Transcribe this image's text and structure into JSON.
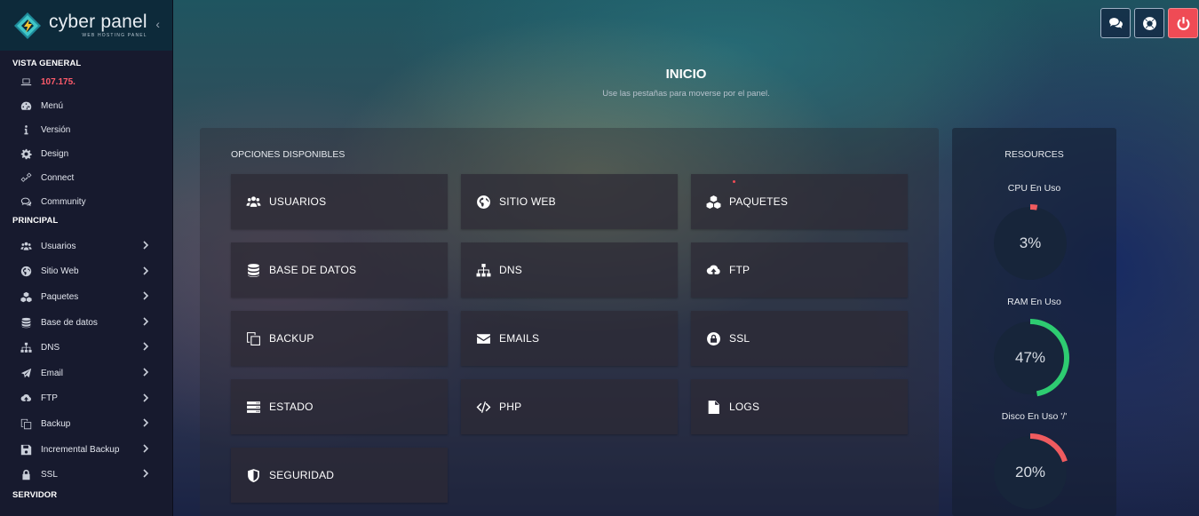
{
  "brand": {
    "name": "cyber panel",
    "subtitle": "WEB HOSTING PANEL"
  },
  "sidebar": {
    "overview_title": "VISTA GENERAL",
    "overview_items": [
      {
        "label": "107.175.",
        "icon": "laptop-icon"
      },
      {
        "label": "Menú",
        "icon": "dashboard-icon"
      },
      {
        "label": "Versión",
        "icon": "info-icon"
      },
      {
        "label": "Design",
        "icon": "gear-icon"
      },
      {
        "label": "Connect",
        "icon": "link-icon"
      },
      {
        "label": "Community",
        "icon": "comments-icon"
      }
    ],
    "main_title": "PRINCIPAL",
    "main_items": [
      {
        "label": "Usuarios",
        "icon": "users-icon"
      },
      {
        "label": "Sitio Web",
        "icon": "globe-icon"
      },
      {
        "label": "Paquetes",
        "icon": "cubes-icon"
      },
      {
        "label": "Base de datos",
        "icon": "database-icon"
      },
      {
        "label": "DNS",
        "icon": "sitemap-icon"
      },
      {
        "label": "Email",
        "icon": "paper-plane-icon"
      },
      {
        "label": "FTP",
        "icon": "cloud-upload-icon"
      },
      {
        "label": "Backup",
        "icon": "copy-icon"
      },
      {
        "label": "Incremental Backup",
        "icon": "save-icon"
      },
      {
        "label": "SSL",
        "icon": "lock-icon"
      }
    ],
    "server_title": "SERVIDOR"
  },
  "header": {
    "title": "INICIO",
    "subtitle": "Use las pestañas para moverse por el panel.",
    "buttons": [
      "comments-icon",
      "life-ring-icon",
      "power-icon"
    ]
  },
  "options": {
    "title": "OPCIONES DISPONIBLES",
    "cards": [
      {
        "label": "USUARIOS",
        "icon": "users-icon"
      },
      {
        "label": "SITIO WEB",
        "icon": "globe-icon"
      },
      {
        "label": "PAQUETES",
        "icon": "cubes-icon"
      },
      {
        "label": "BASE DE DATOS",
        "icon": "database-icon"
      },
      {
        "label": "DNS",
        "icon": "sitemap-icon"
      },
      {
        "label": "FTP",
        "icon": "cloud-upload-icon"
      },
      {
        "label": "BACKUP",
        "icon": "copy-icon"
      },
      {
        "label": "EMAILS",
        "icon": "envelope-icon"
      },
      {
        "label": "SSL",
        "icon": "lock-icon"
      },
      {
        "label": "ESTADO",
        "icon": "server-icon"
      },
      {
        "label": "PHP",
        "icon": "code-icon"
      },
      {
        "label": "LOGS",
        "icon": "file-icon"
      },
      {
        "label": "SEGURIDAD",
        "icon": "shield-icon"
      }
    ]
  },
  "resources": {
    "title": "RESOURCES",
    "gauges": [
      {
        "label": "CPU En Uso",
        "value": "3%",
        "percent": 3,
        "color": "#ef5b5f"
      },
      {
        "label": "RAM En Uso",
        "value": "47%",
        "percent": 47,
        "color": "#2ecc71"
      },
      {
        "label": "Disco En Uso '/'",
        "value": "20%",
        "percent": 20,
        "color": "#ef5b5f"
      }
    ],
    "track_color": "#1e2a3a"
  },
  "colors": {
    "accent": "#ef4b55",
    "ip_text": "#ff5b6b"
  }
}
